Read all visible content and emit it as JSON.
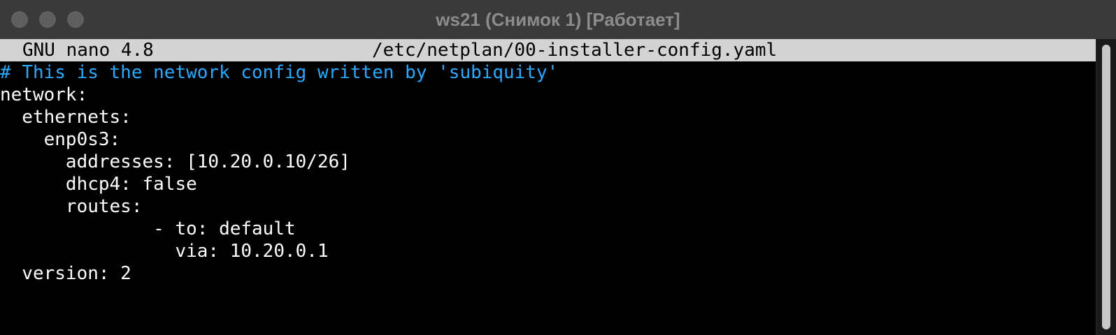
{
  "window": {
    "title": "ws21 (Снимок 1) [Работает]"
  },
  "nano": {
    "version_label": "GNU nano 4.8",
    "file_path": "/etc/netplan/00-installer-config.yaml"
  },
  "file_lines": [
    "# This is the network config written by 'subiquity'",
    "network:",
    "  ethernets:",
    "    enp0s3:",
    "      addresses: [10.20.0.10/26]",
    "      dhcp4: false",
    "      routes:",
    "              - to: default",
    "                via: 10.20.0.1",
    "  version: 2"
  ],
  "colors": {
    "comment": "#2aa9ff",
    "text": "#ffffff",
    "header_bg": "#d3d3d3",
    "background": "#000000"
  }
}
